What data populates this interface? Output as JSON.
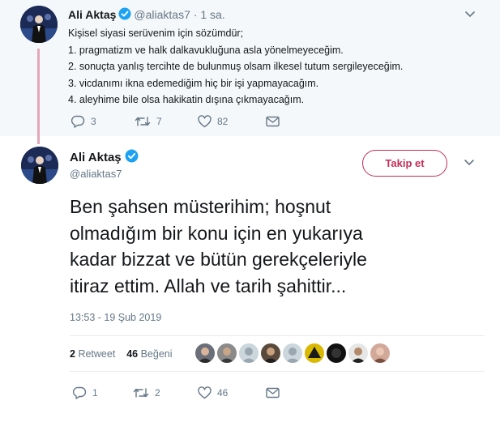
{
  "parent_tweet": {
    "author_name": "Ali Aktaş",
    "author_handle": "@aliaktas7",
    "separator": "·",
    "time": "1 sa.",
    "lines": [
      "Kişisel siyasi serüvenim için sözümdür;",
      "1. pragmatizm ve halk dalkavukluğuna asla yönelmeyeceğim.",
      "2. sonuçta yanlış tercihte de bulunmuş olsam ilkesel tutum sergileyeceğim.",
      "3. vicdanımı ikna edemediğim hiç bir işi yapmayacağım.",
      "4. aleyhime bile olsa hakikatin dışına çıkmayacağım."
    ],
    "replies": "3",
    "retweets": "7",
    "likes": "82"
  },
  "main_tweet": {
    "author_name": "Ali Aktaş",
    "author_handle": "@aliaktas7",
    "follow_label": "Takip et",
    "lines": [
      "Ben şahsen müsterihim; hoşnut",
      "olmadığım bir konu için en yukarıya",
      "kadar bizzat ve bütün gerekçeleriyle",
      "itiraz ettim. Allah ve tarih şahittir..."
    ],
    "timestamp": "13:53 - 19 Şub 2019",
    "retweet_count": "2",
    "retweet_label": "Retweet",
    "like_count": "46",
    "like_label": "Beğeni",
    "replies": "1",
    "retweets": "2",
    "likes": "46"
  },
  "colors": {
    "accent": "#c12d57",
    "verified": "#1da1f2",
    "muted": "#657786",
    "thread_line": "#e2a7b8"
  },
  "liker_avatars": [
    "#6b6f7a",
    "#8a8a8a",
    "#b8c4cc",
    "#5a4a3c",
    "#c9d2d8",
    "#d8b800",
    "#111111",
    "#3c3c3c",
    "#d2a89a"
  ]
}
